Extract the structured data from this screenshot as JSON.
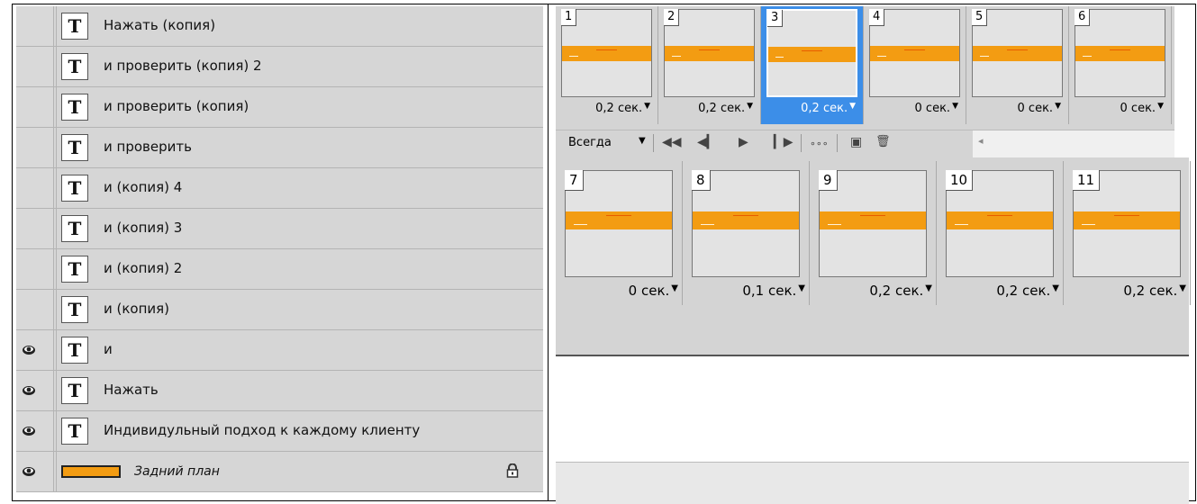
{
  "layers": [
    {
      "name": "Нажать (копия)",
      "visible": false,
      "type": "text"
    },
    {
      "name": "и проверить (копия) 2",
      "visible": false,
      "type": "text"
    },
    {
      "name": "и проверить (копия)",
      "visible": false,
      "type": "text"
    },
    {
      "name": "и проверить",
      "visible": false,
      "type": "text"
    },
    {
      "name": "и (копия) 4",
      "visible": false,
      "type": "text"
    },
    {
      "name": "и (копия) 3",
      "visible": false,
      "type": "text"
    },
    {
      "name": "и (копия) 2",
      "visible": false,
      "type": "text"
    },
    {
      "name": "и (копия)",
      "visible": false,
      "type": "text"
    },
    {
      "name": "и",
      "visible": true,
      "type": "text"
    },
    {
      "name": "Нажать",
      "visible": true,
      "type": "text"
    },
    {
      "name": "Индивидульный подход к каждому клиенту",
      "visible": true,
      "type": "text"
    },
    {
      "name": "Задний план",
      "visible": true,
      "type": "background",
      "locked": true
    }
  ],
  "text_layer_glyph": "T",
  "colors": {
    "accent_orange": "#f39c12",
    "selection_blue": "#3c8ee8",
    "panel_gray": "#d6d6d6"
  },
  "animation": {
    "frames_top": [
      {
        "num": "1",
        "delay": "0,2 сек."
      },
      {
        "num": "2",
        "delay": "0,2 сек."
      },
      {
        "num": "3",
        "delay": "0,2 сек.",
        "selected": true
      },
      {
        "num": "4",
        "delay": "0 сек."
      },
      {
        "num": "5",
        "delay": "0 сек."
      },
      {
        "num": "6",
        "delay": "0 сек."
      }
    ],
    "frames_bottom": [
      {
        "num": "7",
        "delay": "0 сек."
      },
      {
        "num": "8",
        "delay": "0,1 сек."
      },
      {
        "num": "9",
        "delay": "0,2 сек."
      },
      {
        "num": "10",
        "delay": "0,2 сек."
      },
      {
        "num": "11",
        "delay": "0,2 сек."
      }
    ],
    "loop_option": "Всегда",
    "delay_arrow": "▼",
    "controls": {
      "first": "◀◀",
      "prev": "◀▎",
      "play": "▶",
      "next": "▎▶",
      "tween": "∘∘∘",
      "duplicate": "▣",
      "delete": "🗑",
      "scroll_left": "◂"
    }
  }
}
